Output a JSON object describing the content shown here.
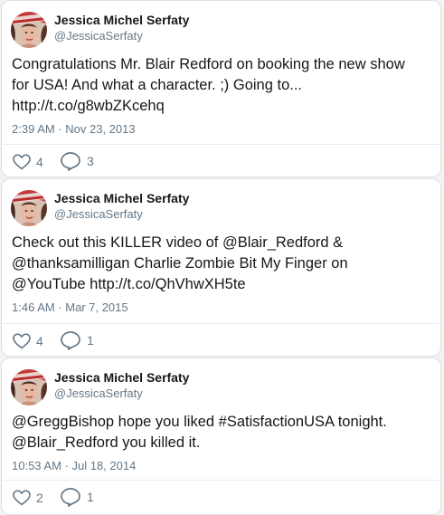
{
  "tweets": [
    {
      "name": "Jessica Michel Serfaty",
      "handle": "@JessicaSerfaty",
      "lines": [
        "Congratulations Mr. Blair Redford on booking the new show",
        "for USA! And what a character. ;) Going to...",
        "http://t.co/g8wbZKcehq"
      ],
      "timestamp": "2:39 AM · Nov 23, 2013",
      "likes": "4",
      "replies": "3"
    },
    {
      "name": "Jessica Michel Serfaty",
      "handle": "@JessicaSerfaty",
      "lines": [
        "Check out this KILLER video of @Blair_Redford &",
        "@thanksamilligan Charlie Zombie Bit My Finger on",
        "@YouTube http://t.co/QhVhwXH5te"
      ],
      "timestamp": "1:46 AM · Mar 7, 2015",
      "likes": "4",
      "replies": "1"
    },
    {
      "name": "Jessica Michel Serfaty",
      "handle": "@JessicaSerfaty",
      "lines": [
        "@GreggBishop hope you liked #SatisfactionUSA tonight.",
        "@Blair_Redford you killed it."
      ],
      "timestamp": "10:53 AM · Jul 18, 2014",
      "likes": "2",
      "replies": "1"
    }
  ],
  "icons": {
    "like": "heart-icon",
    "reply": "speech-bubble-icon"
  },
  "colors": {
    "text": "#14171a",
    "secondary": "#657786",
    "border": "#dcdfe3"
  }
}
